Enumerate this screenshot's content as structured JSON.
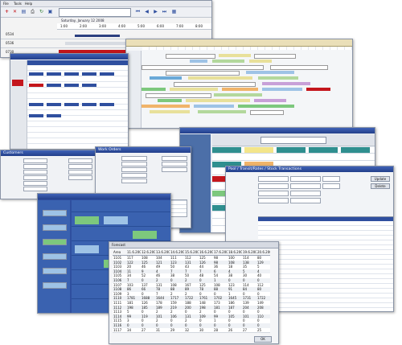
{
  "main_window": {
    "menu": [
      "File",
      "Tools",
      "Help"
    ],
    "date_label": "Saturday, January 12 2008",
    "time_ticks": [
      "1:00",
      "2:00",
      "3:00",
      "4:00",
      "5:00",
      "6:00",
      "7:00",
      "8:00"
    ],
    "row_labels": [
      "0534",
      "0536",
      "0730"
    ]
  },
  "forecast_window": {
    "title": "Forecast",
    "column_dates": [
      "11.6.2007",
      "12.6.2007",
      "13.6.2007",
      "14.6.2007",
      "15.6.2007",
      "16.6.2007",
      "17.6.2007",
      "18.6.2007",
      "19.6.2007",
      "20.6.2007"
    ],
    "row_label_header": "Area",
    "rows": [
      {
        "label": "1101",
        "values": [
          "117",
          "108",
          "104",
          "111",
          "112",
          "125",
          "98",
          "100",
          "114",
          "80"
        ]
      },
      {
        "label": "1102",
        "values": [
          "122",
          "125",
          "121",
          "123",
          "131",
          "126",
          "98",
          "108",
          "138",
          "129"
        ]
      },
      {
        "label": "1103",
        "values": [
          "20",
          "46",
          "49",
          "50",
          "43",
          "44",
          "36",
          "18",
          "35",
          "5"
        ]
      },
      {
        "label": "1104",
        "values": [
          "11",
          "9",
          "4",
          "7",
          "7",
          "7",
          "6",
          "4",
          "5",
          "4"
        ]
      },
      {
        "label": "1105",
        "values": [
          "34",
          "52",
          "46",
          "38",
          "50",
          "48",
          "54",
          "38",
          "30",
          "40"
        ]
      },
      {
        "label": "1106",
        "values": [
          "7",
          "0",
          "2",
          "0",
          "2",
          "0",
          "1",
          "0",
          "0",
          "0"
        ]
      },
      {
        "label": "1107",
        "values": [
          "103",
          "137",
          "131",
          "108",
          "167",
          "125",
          "108",
          "123",
          "114",
          "112"
        ]
      },
      {
        "label": "1108",
        "values": [
          "86",
          "66",
          "78",
          "88",
          "89",
          "78",
          "88",
          "91",
          "84",
          "80"
        ]
      },
      {
        "label": "1109",
        "values": [
          "3",
          "0",
          "7",
          "2",
          "2",
          "0",
          "0",
          "1",
          "0",
          "0"
        ]
      },
      {
        "label": "1110",
        "values": [
          "1781",
          "1688",
          "1644",
          "1717",
          "1722",
          "1761",
          "1702",
          "1645",
          "1731",
          "1722"
        ]
      },
      {
        "label": "1111",
        "values": [
          "181",
          "126",
          "178",
          "159",
          "188",
          "148",
          "173",
          "186",
          "139",
          "149"
        ]
      },
      {
        "label": "1112",
        "values": [
          "198",
          "185",
          "189",
          "219",
          "200",
          "198",
          "181",
          "187",
          "204",
          "208"
        ]
      },
      {
        "label": "1113",
        "values": [
          "5",
          "0",
          "2",
          "2",
          "0",
          "2",
          "0",
          "0",
          "0",
          "0"
        ]
      },
      {
        "label": "1114",
        "values": [
          "99",
          "119",
          "101",
          "106",
          "131",
          "109",
          "99",
          "105",
          "101",
          "110"
        ]
      },
      {
        "label": "1115",
        "values": [
          "3",
          "0",
          "2",
          "0",
          "2",
          "0",
          "1",
          "0",
          "0",
          "0"
        ]
      },
      {
        "label": "1116",
        "values": [
          "0",
          "0",
          "0",
          "0",
          "0",
          "0",
          "0",
          "0",
          "0",
          "0"
        ]
      },
      {
        "label": "1117",
        "values": [
          "34",
          "27",
          "31",
          "29",
          "32",
          "30",
          "28",
          "26",
          "27",
          "25"
        ]
      }
    ],
    "ok_label": "OK"
  },
  "workorder_window": {
    "title": "Work Orders"
  },
  "customers_window": {
    "title": "Customers"
  },
  "transit_window": {
    "title": "Pool / Transit/Rates / Stock Transactions",
    "tabs": [
      "Update",
      "Delete"
    ]
  },
  "colors": {
    "titlebar": "#2f4f9f",
    "accent_red": "#c4161c",
    "grid_border": "#8a94a6"
  }
}
